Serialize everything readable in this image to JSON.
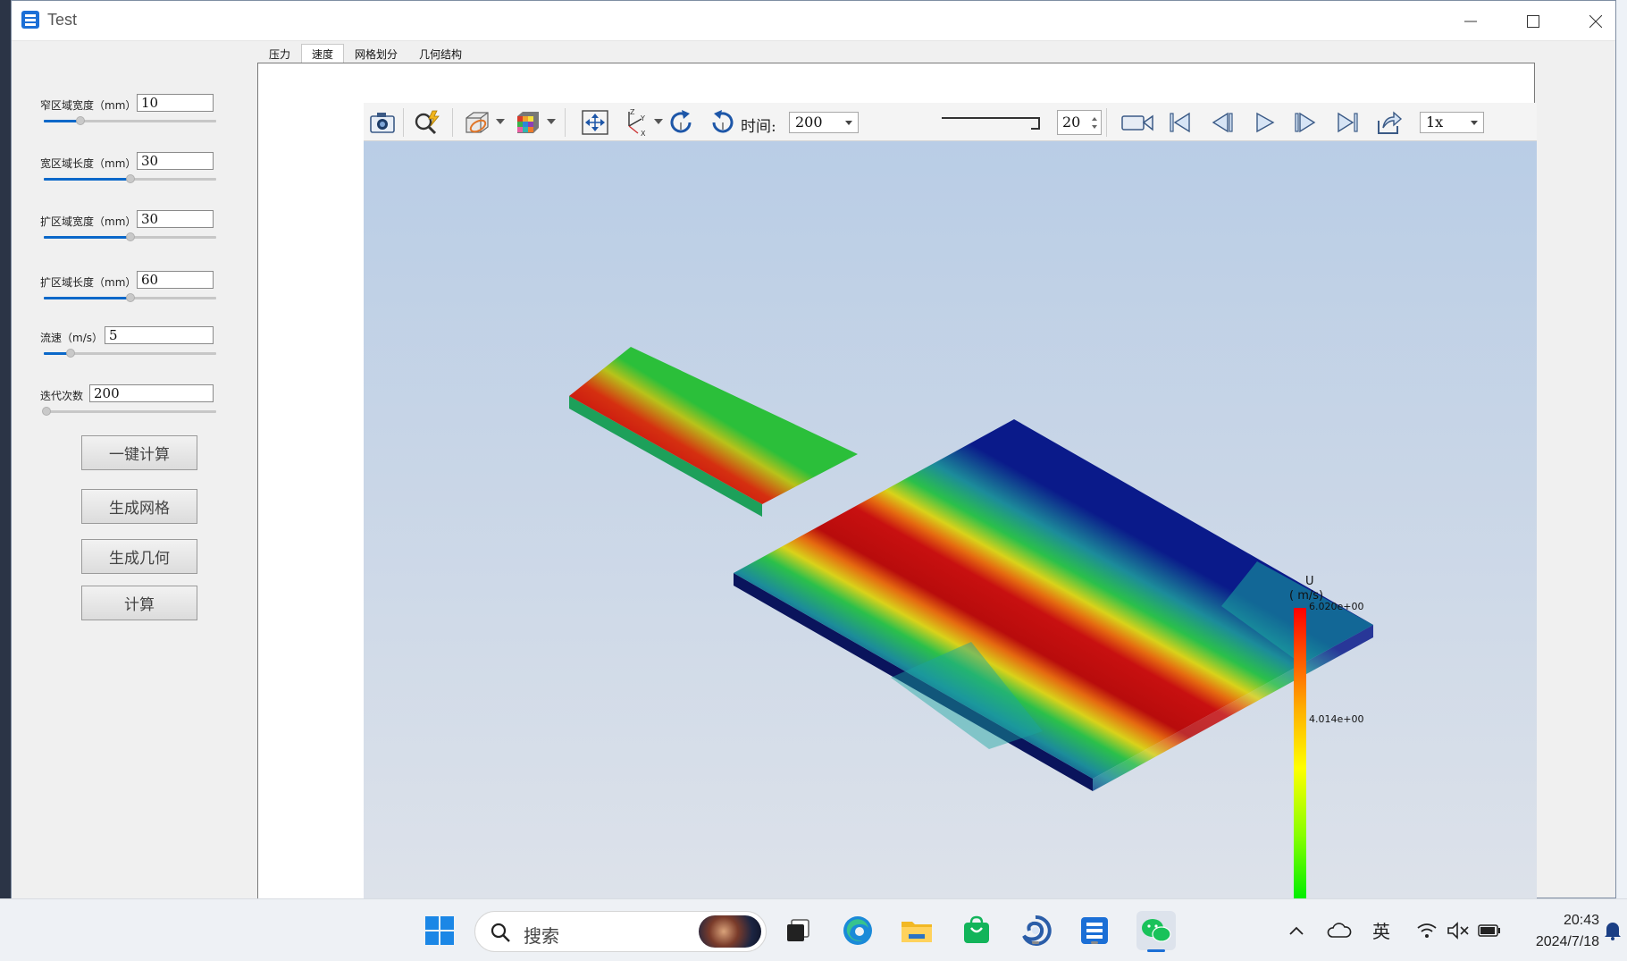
{
  "window": {
    "title": "Test"
  },
  "params": [
    {
      "label": "窄区域宽度（mm）",
      "value": "10"
    },
    {
      "label": "宽区域长度（mm）",
      "value": "30"
    },
    {
      "label": "扩区域宽度（mm）",
      "value": "30"
    },
    {
      "label": "扩区域长度（mm）",
      "value": "60"
    },
    {
      "label": "流速（m/s）",
      "value": "5"
    },
    {
      "label": "迭代次数",
      "value": "200"
    }
  ],
  "buttons": {
    "one_click": "一键计算",
    "gen_mesh": "生成网格",
    "gen_geometry": "生成几何",
    "compute": "计算"
  },
  "tabs": [
    "压力",
    "速度",
    "网格划分",
    "几何结构"
  ],
  "active_tab": "速度",
  "toolbar": {
    "time_label": "时间:",
    "time_value": "200",
    "frame_value": "20",
    "speed_value": "1x",
    "icons": [
      "camera-icon",
      "zoom-select-icon",
      "clip-box-icon",
      "color-cube-icon",
      "fit-view-icon",
      "axes-icon",
      "rotate-cw-icon",
      "rotate-ccw-icon",
      "record-icon",
      "first-frame-icon",
      "prev-frame-icon",
      "play-icon",
      "next-frame-icon",
      "last-frame-icon",
      "export-icon"
    ]
  },
  "legend": {
    "field": "U",
    "unit": "( m/s)",
    "max_label": "6.020e+00",
    "mid_label": "4.014e+00",
    "colors": [
      "#ff0000",
      "#ffff00",
      "#00ff00"
    ]
  },
  "taskbar": {
    "search_placeholder": "搜索",
    "ime": "英",
    "time": "20:43",
    "date": "2024/7/18"
  }
}
